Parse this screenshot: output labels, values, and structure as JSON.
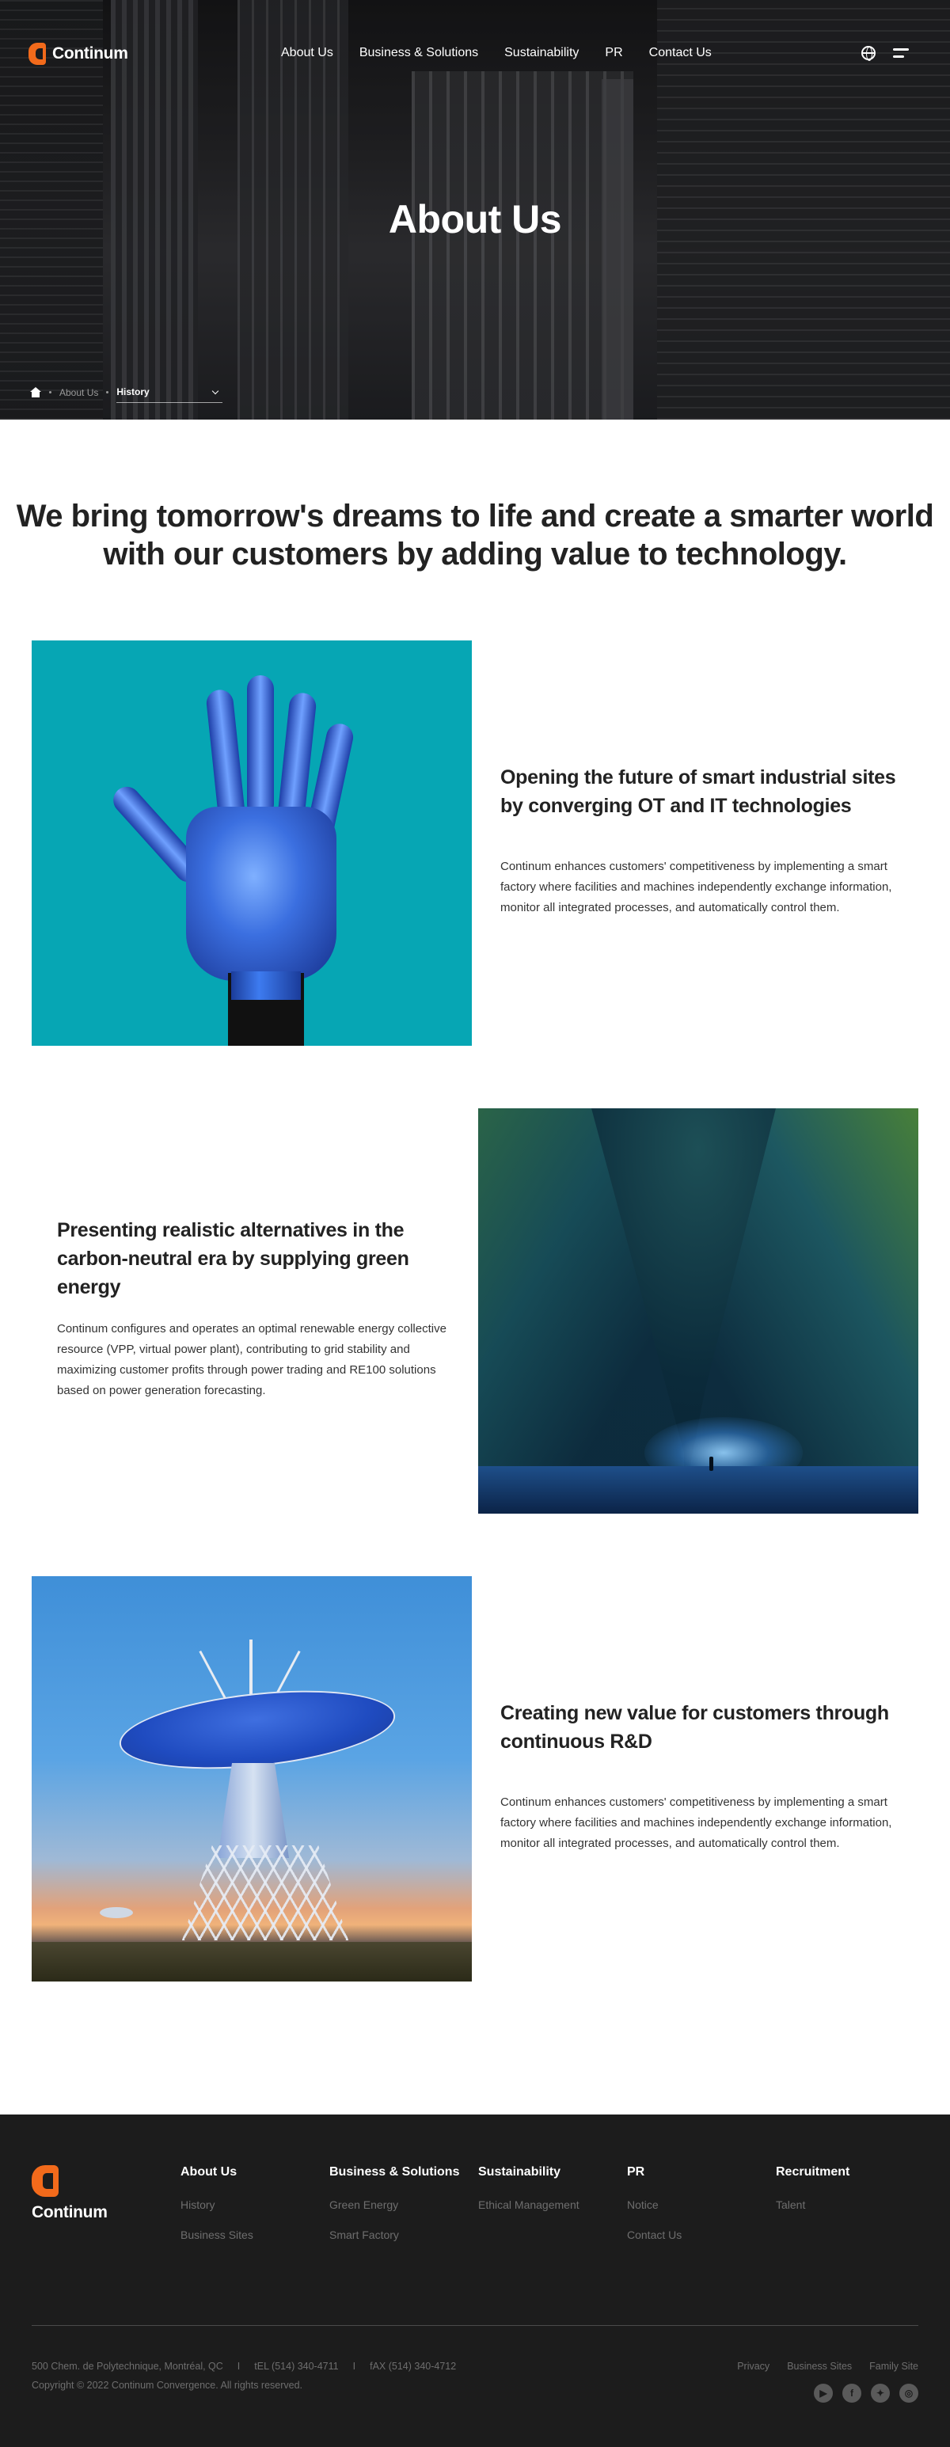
{
  "header": {
    "logo_text": "Continum",
    "nav": [
      "About Us",
      "Business & Solutions",
      "Sustainability",
      "PR",
      "Contact Us"
    ],
    "language_icon": "globe-icon",
    "menu_icon": "hamburger-icon"
  },
  "hero": {
    "title": "About Us",
    "breadcrumb": {
      "home_icon": "home-icon",
      "parent": "About Us",
      "current": "History",
      "dropdown_icon": "chevron-down-icon"
    }
  },
  "intro": {
    "line1": "We bring tomorrow's dreams to life and create a smarter world",
    "line2": "with our customers by adding value to technology."
  },
  "features": [
    {
      "title_line1": "Opening the future of smart industrial sites",
      "title_line2": "by converging OT and IT technologies",
      "body": "Continum enhances customers' competitiveness by implementing a smart factory where facilities and machines independently exchange information, monitor all integrated processes, and automatically control them.",
      "image": "robot-hand-image"
    },
    {
      "title_line1": "Presenting realistic alternatives in the",
      "title_line2": "carbon-neutral era by supplying green",
      "title_line3": "energy",
      "body": "Continum configures and operates an optimal renewable energy collective resource (VPP, virtual power plant), contributing to grid stability and maximizing customer profits through power trading and RE100 solutions based on power generation forecasting.",
      "image": "night-canyon-image"
    },
    {
      "title_line1": "Creating new value for customers through",
      "title_line2": "continuous R&D",
      "body": "Continum enhances customers' competitiveness by implementing a smart factory where facilities and machines independently exchange information, monitor all integrated processes, and automatically control them.",
      "image": "radio-telescope-image"
    }
  ],
  "footer": {
    "logo_text": "Continum",
    "columns": [
      {
        "title": "About Us",
        "links": [
          "History",
          "Business Sites"
        ]
      },
      {
        "title": "Business & Solutions",
        "links": [
          "Green Energy",
          "Smart Factory"
        ]
      },
      {
        "title": "Sustainability",
        "links": [
          "Ethical Management"
        ]
      },
      {
        "title": "PR",
        "links": [
          "Notice",
          "Contact Us"
        ]
      },
      {
        "title": "Recruitment",
        "links": [
          "Talent"
        ]
      }
    ],
    "address": "500 Chem. de Polytechnique, Montréal, QC",
    "separator": "I",
    "tel": "tEL (514) 340-4711",
    "fax": "fAX (514) 340-4712",
    "copyright": "Copyright © 2022 Continum Convergence. All rights reserved.",
    "bottom_links": [
      "Privacy",
      "Business Sites",
      "Family Site"
    ],
    "social": [
      "youtube-icon",
      "facebook-icon",
      "twitter-icon",
      "instagram-icon"
    ],
    "colors": {
      "background": "#1c1c1c",
      "accent": "#f26a1b"
    }
  }
}
